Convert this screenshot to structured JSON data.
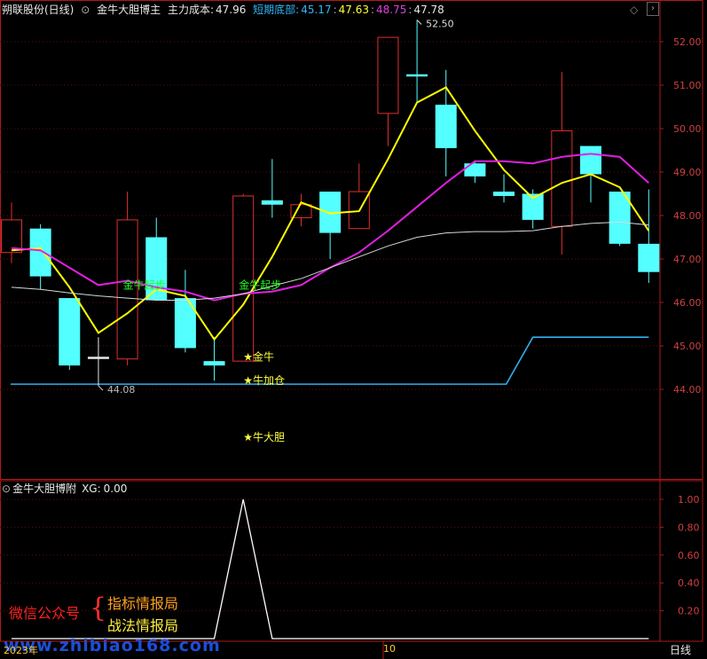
{
  "colors": {
    "background": "#000000",
    "frame": "#b01818",
    "grid": "#5a0f0f",
    "up_candle": "#e03030",
    "down_candle": "#54ffff",
    "ma_yellow": "#ffff00",
    "ma_magenta": "#e020e0",
    "ma_white": "#d8d8d8",
    "cost_line": "#30b0f0",
    "signal_text_green": "#20ff20",
    "signal_text_yellow": "#ffff40",
    "axis_text": "#d04040",
    "indicator_line": "#ffffff"
  },
  "header": {
    "stock_name": "朔联股份(日线)",
    "indicator_name": "金牛大胆博主",
    "cost_label": "主力成本:",
    "cost_value": "47.96",
    "bottom_label": "短期底部:",
    "bottom_value": "45.17",
    "val_yellow": "47.63",
    "val_magenta": "48.75",
    "val_white": "47.78"
  },
  "sub_header": {
    "name": "金牛大胆博附",
    "xg_label": "XG:",
    "xg_value": "0.00"
  },
  "footer": {
    "year_label": "2023年",
    "month_label": "10",
    "period_label": "日线"
  },
  "watermark": {
    "left": "微信公众号",
    "brace": "{",
    "line1": "指标情报局",
    "line2": "战法情报局",
    "url": "www.zhibiao168.com"
  },
  "icons": {
    "collapse_main": "chevron-down-icon",
    "collapse_sub": "chevron-down-icon",
    "diamond": "diamond-icon",
    "more": "chevron-right-icon"
  },
  "chart_data": [
    {
      "type": "candlestick",
      "title": "",
      "ylim": [
        43.6,
        52.6
      ],
      "y_ticks": [
        "52.00",
        "51.00",
        "50.00",
        "49.00",
        "48.00",
        "47.00",
        "46.00",
        "45.00",
        "44.00"
      ],
      "candles": [
        {
          "o": 47.15,
          "c": 47.9,
          "h": 48.3,
          "l": 46.9,
          "dir": "up"
        },
        {
          "o": 47.7,
          "c": 46.6,
          "h": 47.8,
          "l": 46.3,
          "dir": "down"
        },
        {
          "o": 46.1,
          "c": 44.55,
          "h": 46.1,
          "l": 44.45,
          "dir": "down"
        },
        {
          "o": 44.75,
          "c": 44.75,
          "h": 45.2,
          "l": 44.08,
          "dir": "doji"
        },
        {
          "o": 44.7,
          "c": 47.9,
          "h": 48.55,
          "l": 44.55,
          "dir": "up"
        },
        {
          "o": 47.5,
          "c": 46.05,
          "h": 47.95,
          "l": 46.05,
          "dir": "down"
        },
        {
          "o": 46.1,
          "c": 44.95,
          "h": 46.75,
          "l": 44.85,
          "dir": "down"
        },
        {
          "o": 44.65,
          "c": 44.55,
          "h": 45.2,
          "l": 44.2,
          "dir": "down"
        },
        {
          "o": 44.65,
          "c": 48.45,
          "h": 48.5,
          "l": 44.65,
          "dir": "up"
        },
        {
          "o": 48.35,
          "c": 48.25,
          "h": 49.3,
          "l": 47.95,
          "dir": "down"
        },
        {
          "o": 47.95,
          "c": 48.25,
          "h": 48.5,
          "l": 47.75,
          "dir": "up"
        },
        {
          "o": 48.55,
          "c": 47.6,
          "h": 48.55,
          "l": 47.0,
          "dir": "down"
        },
        {
          "o": 47.7,
          "c": 48.55,
          "h": 49.2,
          "l": 47.7,
          "dir": "up"
        },
        {
          "o": 50.35,
          "c": 52.1,
          "h": 52.1,
          "l": 49.6,
          "dir": "up"
        },
        {
          "o": 51.25,
          "c": 51.2,
          "h": 52.5,
          "l": 50.6,
          "dir": "down"
        },
        {
          "o": 50.55,
          "c": 49.55,
          "h": 51.35,
          "l": 48.9,
          "dir": "down"
        },
        {
          "o": 49.2,
          "c": 48.9,
          "h": 49.25,
          "l": 48.75,
          "dir": "down"
        },
        {
          "o": 48.55,
          "c": 48.45,
          "h": 48.95,
          "l": 48.3,
          "dir": "down"
        },
        {
          "o": 48.5,
          "c": 47.9,
          "h": 48.6,
          "l": 47.7,
          "dir": "down"
        },
        {
          "o": 47.75,
          "c": 49.95,
          "h": 51.3,
          "l": 47.1,
          "dir": "up"
        },
        {
          "o": 49.6,
          "c": 48.95,
          "h": 49.6,
          "l": 48.3,
          "dir": "down"
        },
        {
          "o": 48.55,
          "c": 47.35,
          "h": 48.55,
          "l": 47.3,
          "dir": "down"
        },
        {
          "o": 47.35,
          "c": 46.7,
          "h": 48.6,
          "l": 46.45,
          "dir": "down"
        }
      ],
      "series": [
        {
          "color": "yellow",
          "values": [
            47.2,
            47.25,
            46.35,
            45.3,
            45.75,
            46.3,
            46.15,
            45.15,
            45.95,
            47.05,
            48.3,
            48.05,
            48.1,
            49.3,
            50.6,
            50.95,
            49.95,
            49.05,
            48.4,
            48.75,
            48.95,
            48.65,
            47.65
          ]
        },
        {
          "color": "magenta",
          "values": [
            47.25,
            47.2,
            null,
            46.4,
            46.5,
            46.35,
            46.25,
            46.05,
            46.2,
            46.25,
            46.4,
            46.8,
            47.15,
            47.65,
            48.2,
            48.75,
            49.25,
            49.25,
            49.2,
            49.35,
            49.42,
            49.35,
            48.75
          ]
        },
        {
          "color": "white",
          "values": [
            46.35,
            46.3,
            46.22,
            46.15,
            46.1,
            46.05,
            46.05,
            46.1,
            46.2,
            46.38,
            46.55,
            46.8,
            47.05,
            47.3,
            47.5,
            47.6,
            47.63,
            47.63,
            47.65,
            47.75,
            47.82,
            47.85,
            47.78
          ]
        },
        {
          "color": "cost",
          "values": [
            44.12,
            44.12,
            44.12,
            44.12,
            44.12,
            44.12,
            44.12,
            44.12,
            44.12,
            44.12,
            44.12,
            44.12,
            44.12,
            44.12,
            44.12,
            44.12,
            44.12,
            44.12,
            45.2,
            45.2,
            45.2,
            45.2,
            45.2
          ]
        }
      ],
      "annotations": [
        {
          "text": "52.50",
          "index": 14,
          "y": 52.5
        },
        {
          "text": "44.08",
          "index": 3,
          "y": 44.08
        }
      ],
      "signals": [
        {
          "text": "金牛起步",
          "index": 4,
          "y": 46.4,
          "color": "green"
        },
        {
          "text": "金牛起步",
          "index": 8,
          "y": 46.4,
          "color": "green"
        },
        {
          "text": "★金牛",
          "index": 8,
          "y": 44.75,
          "color": "yellow"
        },
        {
          "text": "★牛加仓",
          "index": 8,
          "y": 44.2,
          "color": "yellow"
        },
        {
          "text": "★牛大胆",
          "index": 8,
          "y": 42.9,
          "color": "yellow"
        }
      ]
    },
    {
      "type": "line",
      "title": "",
      "ylim": [
        0,
        1.1
      ],
      "y_ticks": [
        "1.00",
        "0.80",
        "0.60",
        "0.40",
        "0.20"
      ],
      "series": [
        {
          "name": "XG",
          "values": [
            0,
            0,
            0,
            0,
            0,
            0,
            0,
            0,
            1,
            0,
            0,
            0,
            0,
            0,
            0,
            0,
            0,
            0,
            0,
            0,
            0,
            0,
            0
          ]
        }
      ]
    }
  ]
}
